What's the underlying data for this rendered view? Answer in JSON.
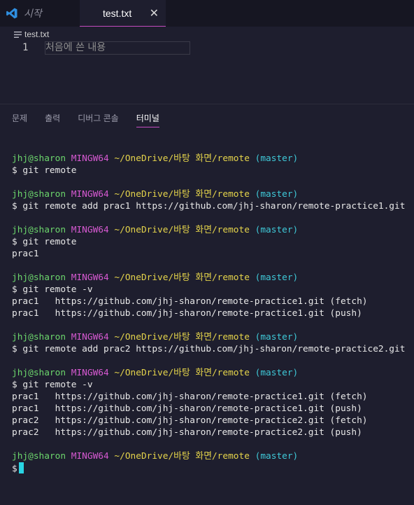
{
  "tabs": [
    {
      "label": "시작",
      "active": false
    },
    {
      "label": "test.txt",
      "active": true
    }
  ],
  "icons": {
    "app": "vscode-icon",
    "close": "close-icon",
    "file": "text-file-icon"
  },
  "breadcrumb": {
    "file": "test.txt"
  },
  "editor": {
    "line_number": "1",
    "text": "처음에 쓴 내용"
  },
  "panel": {
    "tabs": [
      "문제",
      "출력",
      "디버그 콘솔",
      "터미널"
    ],
    "active_tab": "터미널"
  },
  "prompt": {
    "user": "jhj@sharon",
    "system": "MINGW64",
    "path": "~/OneDrive/바탕 화면/remote",
    "branch": "(master)"
  },
  "terminal": [
    {
      "kind": "prompt"
    },
    {
      "kind": "cmd",
      "text": "$ git remote"
    },
    {
      "kind": "blank"
    },
    {
      "kind": "prompt"
    },
    {
      "kind": "cmd",
      "text": "$ git remote add prac1 https://github.com/jhj-sharon/remote-practice1.git"
    },
    {
      "kind": "blank"
    },
    {
      "kind": "prompt"
    },
    {
      "kind": "cmd",
      "text": "$ git remote"
    },
    {
      "kind": "out",
      "text": "prac1"
    },
    {
      "kind": "blank"
    },
    {
      "kind": "prompt"
    },
    {
      "kind": "cmd",
      "text": "$ git remote -v"
    },
    {
      "kind": "out",
      "text": "prac1   https://github.com/jhj-sharon/remote-practice1.git (fetch)"
    },
    {
      "kind": "out",
      "text": "prac1   https://github.com/jhj-sharon/remote-practice1.git (push)"
    },
    {
      "kind": "blank"
    },
    {
      "kind": "prompt"
    },
    {
      "kind": "cmd",
      "text": "$ git remote add prac2 https://github.com/jhj-sharon/remote-practice2.git"
    },
    {
      "kind": "blank"
    },
    {
      "kind": "prompt"
    },
    {
      "kind": "cmd",
      "text": "$ git remote -v"
    },
    {
      "kind": "out",
      "text": "prac1   https://github.com/jhj-sharon/remote-practice1.git (fetch)"
    },
    {
      "kind": "out",
      "text": "prac1   https://github.com/jhj-sharon/remote-practice1.git (push)"
    },
    {
      "kind": "out",
      "text": "prac2   https://github.com/jhj-sharon/remote-practice2.git (fetch)"
    },
    {
      "kind": "out",
      "text": "prac2   https://github.com/jhj-sharon/remote-practice2.git (push)"
    },
    {
      "kind": "blank"
    },
    {
      "kind": "prompt"
    },
    {
      "kind": "cursor",
      "text": "$"
    }
  ],
  "colors": {
    "user": "#6cd66c",
    "system": "#d659d1",
    "path": "#e5d44b",
    "branch": "#3fc9d8",
    "accent": "#c54cc0",
    "cursor": "#29d4e3"
  }
}
